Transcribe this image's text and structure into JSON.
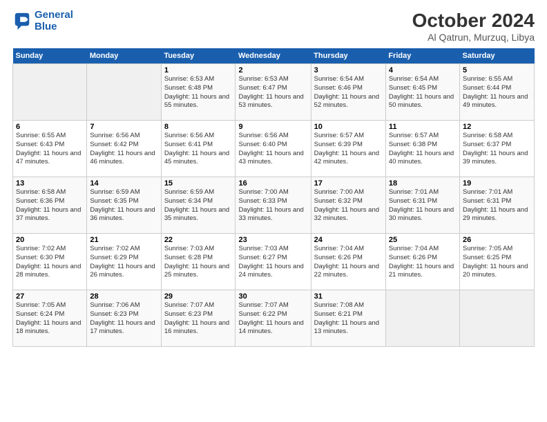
{
  "header": {
    "logo_line1": "General",
    "logo_line2": "Blue",
    "title": "October 2024",
    "subtitle": "Al Qatrun, Murzuq, Libya"
  },
  "weekdays": [
    "Sunday",
    "Monday",
    "Tuesday",
    "Wednesday",
    "Thursday",
    "Friday",
    "Saturday"
  ],
  "weeks": [
    [
      {
        "num": "",
        "info": ""
      },
      {
        "num": "",
        "info": ""
      },
      {
        "num": "1",
        "info": "Sunrise: 6:53 AM\nSunset: 6:48 PM\nDaylight: 11 hours and 55 minutes."
      },
      {
        "num": "2",
        "info": "Sunrise: 6:53 AM\nSunset: 6:47 PM\nDaylight: 11 hours and 53 minutes."
      },
      {
        "num": "3",
        "info": "Sunrise: 6:54 AM\nSunset: 6:46 PM\nDaylight: 11 hours and 52 minutes."
      },
      {
        "num": "4",
        "info": "Sunrise: 6:54 AM\nSunset: 6:45 PM\nDaylight: 11 hours and 50 minutes."
      },
      {
        "num": "5",
        "info": "Sunrise: 6:55 AM\nSunset: 6:44 PM\nDaylight: 11 hours and 49 minutes."
      }
    ],
    [
      {
        "num": "6",
        "info": "Sunrise: 6:55 AM\nSunset: 6:43 PM\nDaylight: 11 hours and 47 minutes."
      },
      {
        "num": "7",
        "info": "Sunrise: 6:56 AM\nSunset: 6:42 PM\nDaylight: 11 hours and 46 minutes."
      },
      {
        "num": "8",
        "info": "Sunrise: 6:56 AM\nSunset: 6:41 PM\nDaylight: 11 hours and 45 minutes."
      },
      {
        "num": "9",
        "info": "Sunrise: 6:56 AM\nSunset: 6:40 PM\nDaylight: 11 hours and 43 minutes."
      },
      {
        "num": "10",
        "info": "Sunrise: 6:57 AM\nSunset: 6:39 PM\nDaylight: 11 hours and 42 minutes."
      },
      {
        "num": "11",
        "info": "Sunrise: 6:57 AM\nSunset: 6:38 PM\nDaylight: 11 hours and 40 minutes."
      },
      {
        "num": "12",
        "info": "Sunrise: 6:58 AM\nSunset: 6:37 PM\nDaylight: 11 hours and 39 minutes."
      }
    ],
    [
      {
        "num": "13",
        "info": "Sunrise: 6:58 AM\nSunset: 6:36 PM\nDaylight: 11 hours and 37 minutes."
      },
      {
        "num": "14",
        "info": "Sunrise: 6:59 AM\nSunset: 6:35 PM\nDaylight: 11 hours and 36 minutes."
      },
      {
        "num": "15",
        "info": "Sunrise: 6:59 AM\nSunset: 6:34 PM\nDaylight: 11 hours and 35 minutes."
      },
      {
        "num": "16",
        "info": "Sunrise: 7:00 AM\nSunset: 6:33 PM\nDaylight: 11 hours and 33 minutes."
      },
      {
        "num": "17",
        "info": "Sunrise: 7:00 AM\nSunset: 6:32 PM\nDaylight: 11 hours and 32 minutes."
      },
      {
        "num": "18",
        "info": "Sunrise: 7:01 AM\nSunset: 6:31 PM\nDaylight: 11 hours and 30 minutes."
      },
      {
        "num": "19",
        "info": "Sunrise: 7:01 AM\nSunset: 6:31 PM\nDaylight: 11 hours and 29 minutes."
      }
    ],
    [
      {
        "num": "20",
        "info": "Sunrise: 7:02 AM\nSunset: 6:30 PM\nDaylight: 11 hours and 28 minutes."
      },
      {
        "num": "21",
        "info": "Sunrise: 7:02 AM\nSunset: 6:29 PM\nDaylight: 11 hours and 26 minutes."
      },
      {
        "num": "22",
        "info": "Sunrise: 7:03 AM\nSunset: 6:28 PM\nDaylight: 11 hours and 25 minutes."
      },
      {
        "num": "23",
        "info": "Sunrise: 7:03 AM\nSunset: 6:27 PM\nDaylight: 11 hours and 24 minutes."
      },
      {
        "num": "24",
        "info": "Sunrise: 7:04 AM\nSunset: 6:26 PM\nDaylight: 11 hours and 22 minutes."
      },
      {
        "num": "25",
        "info": "Sunrise: 7:04 AM\nSunset: 6:26 PM\nDaylight: 11 hours and 21 minutes."
      },
      {
        "num": "26",
        "info": "Sunrise: 7:05 AM\nSunset: 6:25 PM\nDaylight: 11 hours and 20 minutes."
      }
    ],
    [
      {
        "num": "27",
        "info": "Sunrise: 7:05 AM\nSunset: 6:24 PM\nDaylight: 11 hours and 18 minutes."
      },
      {
        "num": "28",
        "info": "Sunrise: 7:06 AM\nSunset: 6:23 PM\nDaylight: 11 hours and 17 minutes."
      },
      {
        "num": "29",
        "info": "Sunrise: 7:07 AM\nSunset: 6:23 PM\nDaylight: 11 hours and 16 minutes."
      },
      {
        "num": "30",
        "info": "Sunrise: 7:07 AM\nSunset: 6:22 PM\nDaylight: 11 hours and 14 minutes."
      },
      {
        "num": "31",
        "info": "Sunrise: 7:08 AM\nSunset: 6:21 PM\nDaylight: 11 hours and 13 minutes."
      },
      {
        "num": "",
        "info": ""
      },
      {
        "num": "",
        "info": ""
      }
    ]
  ]
}
